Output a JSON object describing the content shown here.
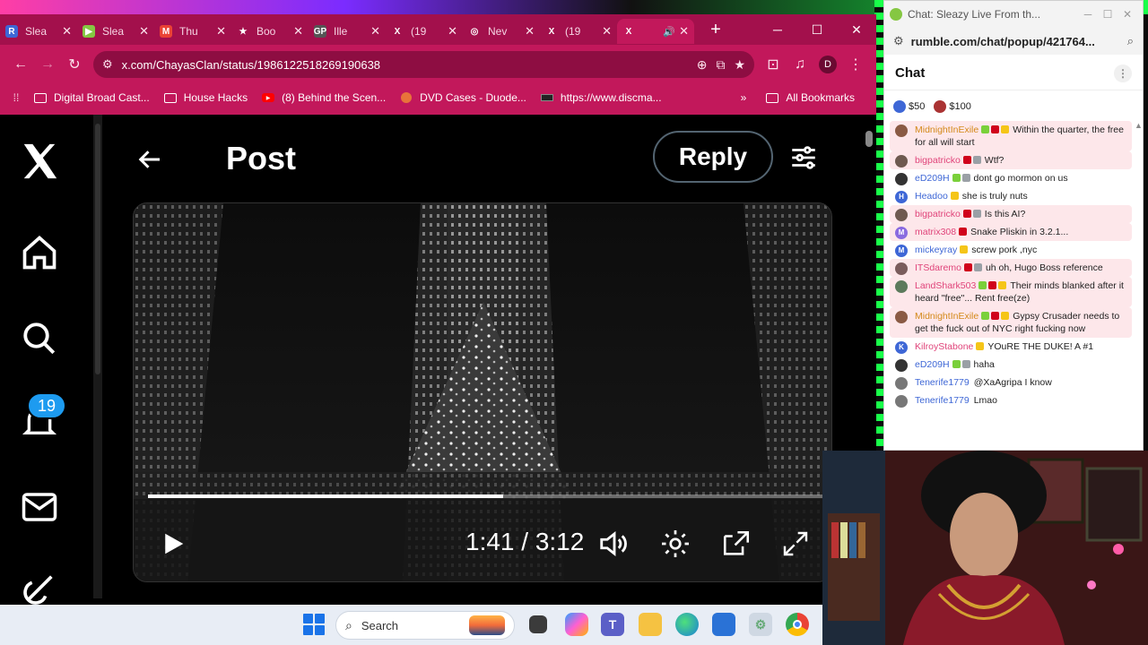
{
  "browser": {
    "tabs": [
      {
        "title": "Slea",
        "fav": "R",
        "fav_color": "#3e67d6"
      },
      {
        "title": "Slea",
        "fav": "▶",
        "fav_color": "#85c742"
      },
      {
        "title": "Thu",
        "fav": "M",
        "fav_color": "#ea4335"
      },
      {
        "title": "Boo",
        "fav": "★",
        "fav_color": "transparent"
      },
      {
        "title": "Ille",
        "fav": "GP",
        "fav_color": "#555"
      },
      {
        "title": "(19",
        "fav": "X",
        "fav_color": "transparent"
      },
      {
        "title": "Nev",
        "fav": "◎",
        "fav_color": "transparent"
      },
      {
        "title": "(19",
        "fav": "X",
        "fav_color": "transparent"
      },
      {
        "title": "",
        "fav": "X",
        "fav_color": "transparent",
        "active": true
      }
    ],
    "url": "x.com/ChayasClan/status/1986122518269190638",
    "profile_initial": "D",
    "bookmarks": [
      {
        "label": "Digital Broad Cast...",
        "icon": "folder"
      },
      {
        "label": "House Hacks",
        "icon": "folder"
      },
      {
        "label": "(8) Behind the Scen...",
        "icon": "youtube"
      },
      {
        "label": "DVD Cases - Duode...",
        "icon": "site"
      },
      {
        "label": "https://www.discma...",
        "icon": "site-dark"
      }
    ],
    "all_bookmarks": "All Bookmarks"
  },
  "x_page": {
    "post_title": "Post",
    "reply_label": "Reply",
    "notification_count": "19",
    "video": {
      "time_text": "1:41 / 3:12",
      "progress": 0.526
    }
  },
  "taskbar": {
    "search_placeholder": "Search"
  },
  "chat": {
    "window_title": "Chat: Sleazy Live From th...",
    "url": "rumble.com/chat/popup/421764...",
    "header": "Chat",
    "rants": [
      {
        "amount": "$50",
        "color": "#3e67d6"
      },
      {
        "amount": "$100",
        "color": "#a33"
      }
    ],
    "messages": [
      {
        "user": "MidnightInExile",
        "text": "Within the quarter, the free for all will start",
        "color": "#d4891a",
        "hl": true,
        "badges": [
          "g",
          "r",
          "y"
        ],
        "av": "#8a5a44"
      },
      {
        "user": "bigpatricko",
        "text": "Wtf?",
        "color": "#e0447a",
        "hl": true,
        "badges": [
          "r",
          "gr"
        ],
        "av": "#6e5a50"
      },
      {
        "user": "eD209H",
        "text": "dont go mormon on us",
        "color": "#3e67d6",
        "hl": false,
        "badges": [
          "g",
          "gr"
        ],
        "av": "#333"
      },
      {
        "user": "Headoo",
        "text": "she is truly nuts",
        "color": "#3e67d6",
        "hl": false,
        "badges": [
          "y"
        ],
        "av": "#3e67d6",
        "letter": "H"
      },
      {
        "user": "bigpatricko",
        "text": "Is this AI?",
        "color": "#e0447a",
        "hl": true,
        "badges": [
          "r",
          "gr"
        ],
        "av": "#6e5a50"
      },
      {
        "user": "matrix308",
        "text": "Snake Pliskin in 3.2.1...",
        "color": "#e0447a",
        "hl": true,
        "badges": [
          "r"
        ],
        "av": "#8a6be0",
        "letter": "M"
      },
      {
        "user": "mickeyray",
        "text": "screw pork ,nyc",
        "color": "#3e67d6",
        "hl": false,
        "badges": [
          "y"
        ],
        "av": "#3e67d6",
        "letter": "M"
      },
      {
        "user": "ITSdaremo",
        "text": "uh oh, Hugo Boss reference",
        "color": "#e0447a",
        "hl": true,
        "badges": [
          "r",
          "gr"
        ],
        "av": "#7a5c5c"
      },
      {
        "user": "LandShark503",
        "text": "Their minds blanked after it heard \"free\"... Rent free(ze)",
        "color": "#e0447a",
        "hl": true,
        "badges": [
          "g",
          "r",
          "y"
        ],
        "av": "#5c7a5c"
      },
      {
        "user": "MidnightInExile",
        "text": "Gypsy Crusader needs to get the fuck out of NYC right fucking now",
        "color": "#d4891a",
        "hl": true,
        "badges": [
          "g",
          "r",
          "y"
        ],
        "av": "#8a5a44"
      },
      {
        "user": "KilroyStabone",
        "text": "YOuRE THE DUKE! A #1",
        "color": "#e0447a",
        "hl": false,
        "badges": [
          "y"
        ],
        "av": "#3e67d6",
        "letter": "K"
      },
      {
        "user": "eD209H",
        "text": "haha",
        "color": "#3e67d6",
        "hl": false,
        "badges": [
          "g",
          "gr"
        ],
        "av": "#333"
      },
      {
        "user": "Tenerife1779",
        "text": "@XaAgripa I know",
        "color": "#3e67d6",
        "hl": false,
        "badges": [],
        "av": "#777",
        "mention": true
      },
      {
        "user": "Tenerife1779",
        "text": "Lmao",
        "color": "#3e67d6",
        "hl": false,
        "badges": [],
        "av": "#777"
      }
    ]
  }
}
